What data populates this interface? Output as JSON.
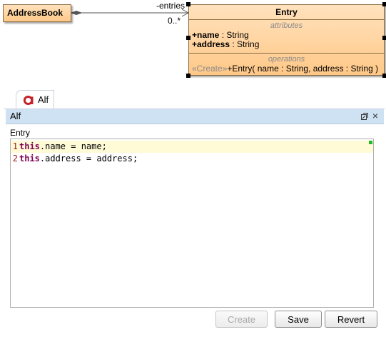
{
  "diagram": {
    "addressbook_class": "AddressBook",
    "entry_class": "Entry",
    "association_role": "-entries",
    "association_multiplicity": "0..*",
    "attributes_title": "attributes",
    "attributes": [
      {
        "name": "+name",
        "type": " : String"
      },
      {
        "name": "+address",
        "type": " : String"
      }
    ],
    "operations_title": "operations",
    "operation": {
      "stereotype": "«Create»",
      "signature": "+Entry( name : String, address : String )"
    },
    "colors": {
      "class_fill": "#ffd19e",
      "class_border": "#8b6a3e"
    }
  },
  "panel": {
    "tab_label": "Alf",
    "title": "Alf",
    "section_label": "Entry",
    "icons": [
      "alf-logo-icon",
      "restore-icon",
      "close-icon"
    ],
    "close_glyph": "×",
    "editor_lines": [
      {
        "number": "1",
        "keyword": "this",
        "rest": ".name = name;"
      },
      {
        "number": "2",
        "keyword": "this",
        "rest": ".address = address;"
      }
    ],
    "buttons": {
      "create": "Create",
      "save": "Save",
      "revert": "Revert"
    },
    "colors": {
      "titlebar": "#cfe2f4",
      "current_line": "#fffbd6",
      "keyword": "#7f0055",
      "line_number": "#9c1a1a",
      "logo": "#c42127"
    }
  }
}
